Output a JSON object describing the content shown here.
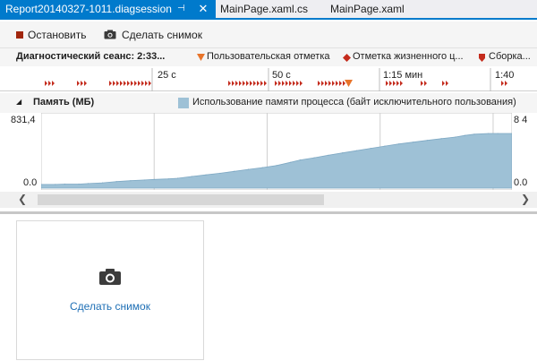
{
  "tabs": [
    {
      "label": "Report20140327-1011.diagsession",
      "active": true
    },
    {
      "label": "MainPage.xaml.cs",
      "active": false
    },
    {
      "label": "MainPage.xaml",
      "active": false
    }
  ],
  "tab_icons": {
    "pin": "pin-icon",
    "close": "close-icon"
  },
  "toolbar": {
    "stop_label": "Остановить",
    "snapshot_label": "Сделать снимок"
  },
  "session": {
    "title": "Диагностический сеанс: 2:33...",
    "legend": [
      {
        "label": "Пользовательская отметка",
        "marker": "orange-triangle-icon",
        "color": "#e8742a"
      },
      {
        "label": "Отметка жизненного ц...",
        "marker": "red-diamond-icon",
        "color": "#c42b1c"
      },
      {
        "label": "Сборка...",
        "marker": "red-down-marker-icon",
        "color": "#c42b1c"
      }
    ]
  },
  "timeline": {
    "ticks": [
      "25 с",
      "50 с",
      "1:15 мин",
      "1:40"
    ]
  },
  "memory": {
    "title": "Память (МБ)",
    "legend": "Использование памяти процесса (байт исключительного пользования)",
    "y_max_label": "831,4",
    "y_min_label": "0.0",
    "y_max_label_right": "8 4",
    "y_min_label_right": "0.0"
  },
  "chart_data": {
    "type": "area",
    "series": [
      {
        "x": [
          0,
          3,
          5,
          8,
          10,
          13,
          16,
          19,
          22,
          24,
          27,
          29,
          32,
          35,
          38,
          41,
          44,
          47,
          50,
          53,
          55,
          58,
          61,
          64,
          67,
          70,
          73,
          76,
          79,
          82,
          85,
          88,
          90,
          92,
          95,
          97,
          100
        ],
        "values": [
          42,
          42,
          46,
          46,
          52,
          60,
          74,
          84,
          92,
          98,
          104,
          112,
          132,
          150,
          168,
          190,
          212,
          232,
          256,
          292,
          318,
          344,
          372,
          398,
          424,
          450,
          476,
          500,
          520,
          540,
          560,
          578,
          596,
          610,
          618,
          618,
          618
        ]
      }
    ],
    "ylim": [
      0,
      831.4
    ],
    "color": "#9ec1d6"
  },
  "snapshot_card": {
    "label": "Сделать снимок",
    "icon": "camera-icon"
  },
  "colors": {
    "accent": "#007acc",
    "chart_fill": "#9ec1d6",
    "stop_red": "#a1260d",
    "link_blue": "#1e6fb5"
  }
}
